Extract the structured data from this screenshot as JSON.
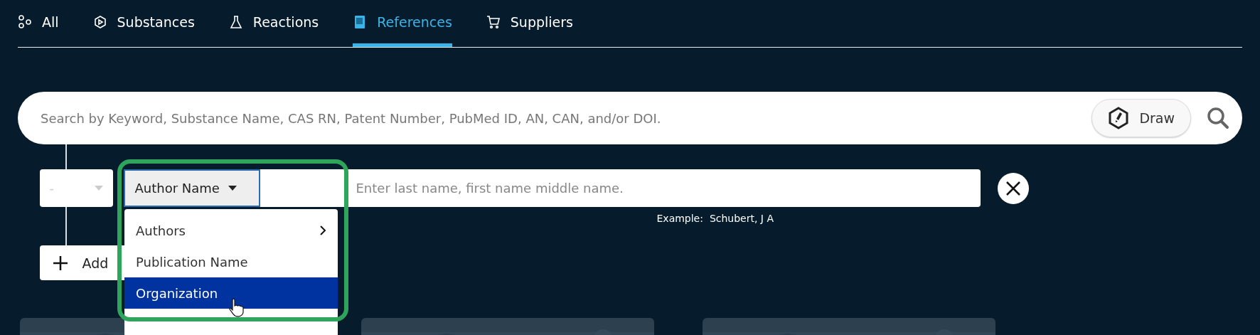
{
  "tabs": [
    {
      "label": "All",
      "selected": false
    },
    {
      "label": "Substances",
      "selected": false
    },
    {
      "label": "Reactions",
      "selected": false
    },
    {
      "label": "References",
      "selected": true
    },
    {
      "label": "Suppliers",
      "selected": false
    }
  ],
  "search": {
    "placeholder": "Search by Keyword, Substance Name, CAS RN, Patent Number, PubMed ID, AN, CAN, and/or DOI.",
    "draw_button": "Draw"
  },
  "query_row": {
    "operator": "-",
    "field": "Author Name",
    "placeholder": "Enter last name, first name middle name.",
    "example_label": "Example:",
    "example_value": "Schubert, J A"
  },
  "add_button": "Add",
  "field_menu": [
    {
      "label": "Authors",
      "submenu": true,
      "selected": false
    },
    {
      "label": "Publication Name",
      "submenu": false,
      "selected": false
    },
    {
      "label": "Organization",
      "submenu": false,
      "selected": true
    }
  ]
}
